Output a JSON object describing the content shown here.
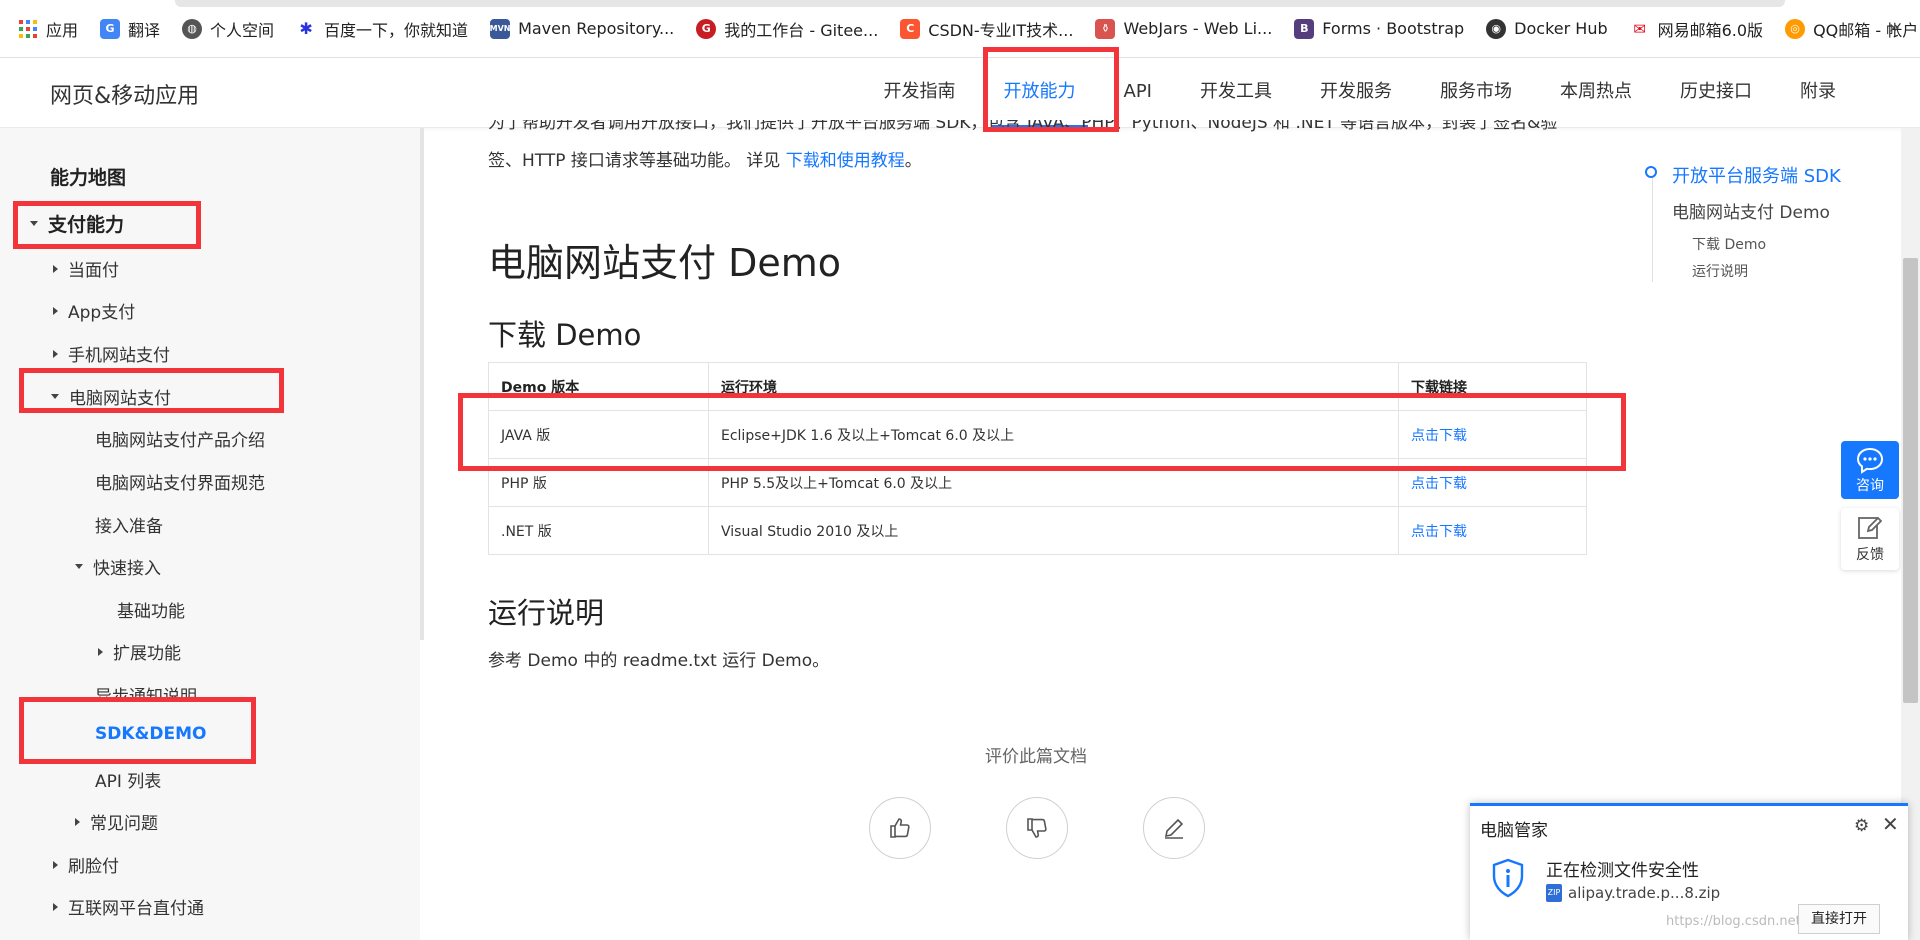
{
  "bookmarks": [
    {
      "label": "应用",
      "icon": "apps-grid-icon",
      "color": "#e94235"
    },
    {
      "label": "翻译",
      "icon": "translate-icon",
      "color": "#4285f4"
    },
    {
      "label": "个人空间",
      "icon": "globe-icon",
      "color": "#555555"
    },
    {
      "label": "百度一下，你就知道",
      "icon": "baidu-paw-icon",
      "color": "#2932e1"
    },
    {
      "label": "Maven Repository...",
      "icon": "maven-icon",
      "color": "#3b5998"
    },
    {
      "label": "我的工作台 - Gitee...",
      "icon": "gitee-icon",
      "color": "#c71d23"
    },
    {
      "label": "CSDN-专业IT技术...",
      "icon": "csdn-icon",
      "color": "#fc5531"
    },
    {
      "label": "WebJars - Web Li...",
      "icon": "webjars-icon",
      "color": "#d9534f"
    },
    {
      "label": "Forms · Bootstrap",
      "icon": "bootstrap-icon",
      "color": "#563d7c"
    },
    {
      "label": "Docker Hub",
      "icon": "docker-icon",
      "color": "#333333"
    },
    {
      "label": "网易邮箱6.0版",
      "icon": "netease-icon",
      "color": "#e60012"
    },
    {
      "label": "QQ邮箱 - 帐户",
      "icon": "qq-mail-icon",
      "color": "#ff9a00"
    }
  ],
  "bookmarks_more": "»",
  "header": {
    "title": "网页&移动应用",
    "tabs": [
      "开发指南",
      "开放能力",
      "API",
      "开发工具",
      "开发服务",
      "服务市场",
      "本周热点",
      "历史接口",
      "附录"
    ],
    "active_tab": "开放能力"
  },
  "sidebar": {
    "map_title": "能力地图",
    "section": "支付能力",
    "items": {
      "dangmianfu": "当面付",
      "app": "App支付",
      "mobile_web": "手机网站支付",
      "pc_web": "电脑网站支付",
      "pc_intro": "电脑网站支付产品介绍",
      "pc_ui": "电脑网站支付界面规范",
      "prep": "接入准备",
      "quick": "快速接入",
      "basic": "基础功能",
      "extend": "扩展功能",
      "async": "异步通知说明",
      "sdk": "SDK&DEMO",
      "api_list": "API 列表",
      "faq": "常见问题",
      "face": "刷脸付",
      "platform": "互联网平台直付通"
    }
  },
  "main": {
    "intro_line1": "为了帮助开发者调用开放接口，我们提供了开放平台服务端 SDK，包含 JAVA、PHP、Python、NodeJS 和 .NET 等语言版本，封装了签名&验",
    "intro_line2_prefix": "签、HTTP 接口请求等基础功能。 详见 ",
    "intro_link": "下载和使用教程",
    "intro_suffix": "。",
    "h1": "电脑网站支付 Demo",
    "h2_download": "下载 Demo",
    "table": {
      "headers": [
        "Demo 版本",
        "运行环境",
        "下载链接"
      ],
      "rows": [
        [
          "JAVA 版",
          "Eclipse+JDK 1.6 及以上+Tomcat 6.0 及以上",
          "点击下载"
        ],
        [
          "PHP 版",
          "PHP 5.5及以上+Tomcat 6.0 及以上",
          "点击下载"
        ],
        [
          ".NET 版",
          "Visual Studio 2010 及以上",
          "点击下载"
        ]
      ]
    },
    "h2_run": "运行说明",
    "run_text": "参考 Demo 中的 readme.txt 运行 Demo。",
    "rate_title": "评价此篇文档"
  },
  "toc": {
    "items": [
      "开放平台服务端 SDK",
      "电脑网站支付 Demo",
      "下载 Demo",
      "运行说明"
    ]
  },
  "float": {
    "consult": "咨询",
    "feedback": "反馈"
  },
  "popup": {
    "title": "电脑管家",
    "message": "正在检测文件安全性",
    "file": "alipay.trade.p...8.zip",
    "button": "直接打开",
    "watermark": "https://blog.csdn.net/..."
  },
  "colors": {
    "accent": "#1677ff",
    "annotation": "#f2353b"
  }
}
